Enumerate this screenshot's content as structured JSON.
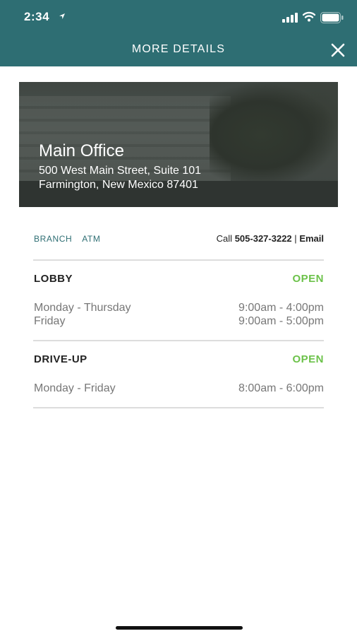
{
  "status_bar": {
    "time": "2:34"
  },
  "header": {
    "title": "MORE DETAILS",
    "close_icon": "close-icon"
  },
  "branch": {
    "name": "Main Office",
    "address_line1": "500 West Main Street, Suite 101",
    "address_line2": "Farmington, New Mexico 87401"
  },
  "tabs": [
    {
      "label": "BRANCH"
    },
    {
      "label": "ATM"
    }
  ],
  "contact": {
    "call_label": "Call",
    "phone": "505-327-3222",
    "separator": "|",
    "email_label": "Email"
  },
  "sections": {
    "lobby": {
      "title": "LOBBY",
      "status": "OPEN",
      "rows": [
        {
          "days": "Monday - Thursday",
          "hours": "9:00am - 4:00pm"
        },
        {
          "days": "Friday",
          "hours": "9:00am - 5:00pm"
        }
      ]
    },
    "drive_up": {
      "title": "DRIVE-UP",
      "status": "OPEN",
      "rows": [
        {
          "days": "Monday - Friday",
          "hours": "8:00am - 6:00pm"
        }
      ]
    }
  },
  "colors": {
    "header_bg": "#2e6e73",
    "open_status": "#6cc24a",
    "tab_text": "#2e6e73"
  }
}
